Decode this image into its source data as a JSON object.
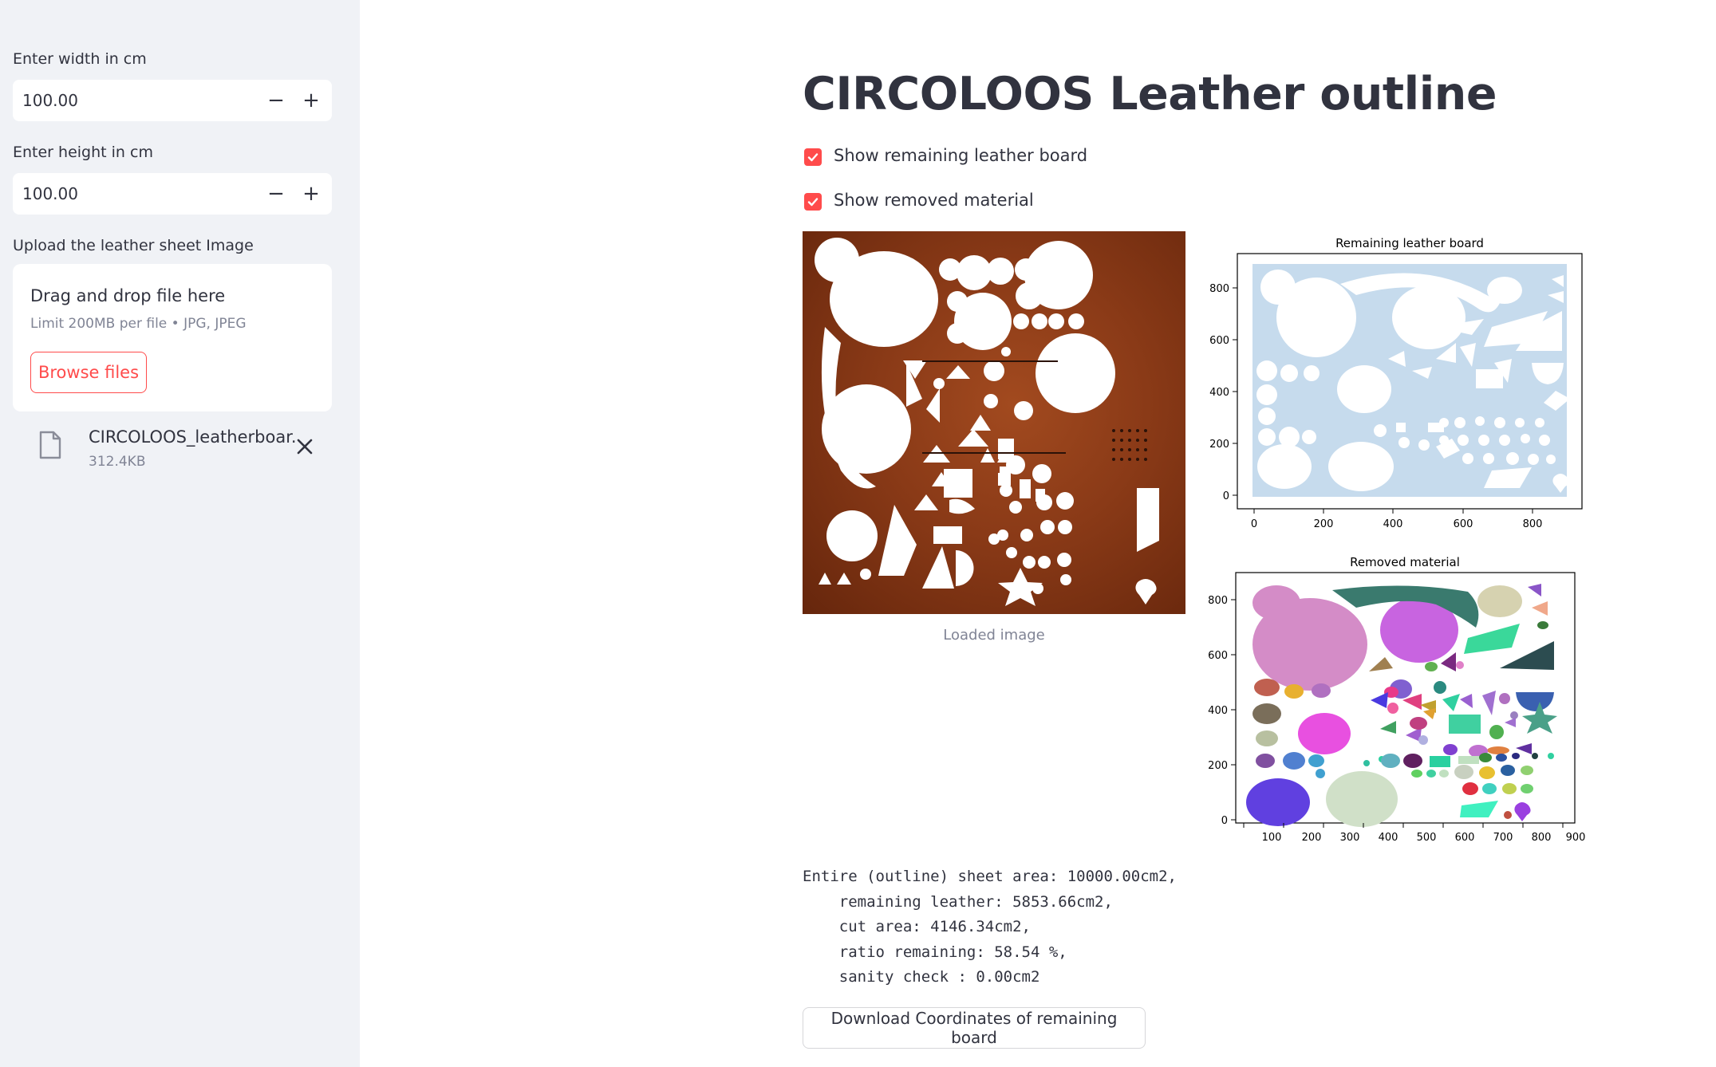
{
  "sidebar": {
    "width_label": "Enter width in cm",
    "width_value": "100.00",
    "height_label": "Enter height in cm",
    "height_value": "100.00",
    "minus": "−",
    "plus": "+",
    "upload_label": "Upload the leather sheet Image",
    "dropzone_title": "Drag and drop file here",
    "dropzone_limit": "Limit 200MB per file • JPG, JPEG",
    "browse_label": "Browse files",
    "file_name": "CIRCOLOOS_leatherboar...",
    "file_size": "312.4KB"
  },
  "main": {
    "title": "CIRCOLOOS Leather outline",
    "checkbox_remaining": "Show remaining leather board",
    "checkbox_removed": "Show removed material",
    "image_caption": "Loaded image",
    "stats": "Entire (outline) sheet area: 10000.00cm2,\n    remaining leather: 5853.66cm2,\n    cut area: 4146.34cm2,\n    ratio remaining: 58.54 %,\n    sanity check : 0.00cm2",
    "download_label": "Download Coordinates of remaining board"
  },
  "plots": {
    "remaining": {
      "title": "Remaining leather board",
      "x_ticks": [
        "0",
        "200",
        "400",
        "600",
        "800"
      ],
      "y_ticks": [
        "0",
        "200",
        "400",
        "600",
        "800"
      ],
      "fill_color": "#c6dbed"
    },
    "removed": {
      "title": "Removed material",
      "x_ticks": [
        "100",
        "200",
        "300",
        "400",
        "500",
        "600",
        "700",
        "800",
        "900"
      ],
      "y_ticks": [
        "0",
        "200",
        "400",
        "600",
        "800"
      ]
    }
  },
  "colors": {
    "accent": "#ff4b4b",
    "sidebar_bg": "#f0f2f6",
    "text": "#31333f",
    "muted": "#808495"
  }
}
